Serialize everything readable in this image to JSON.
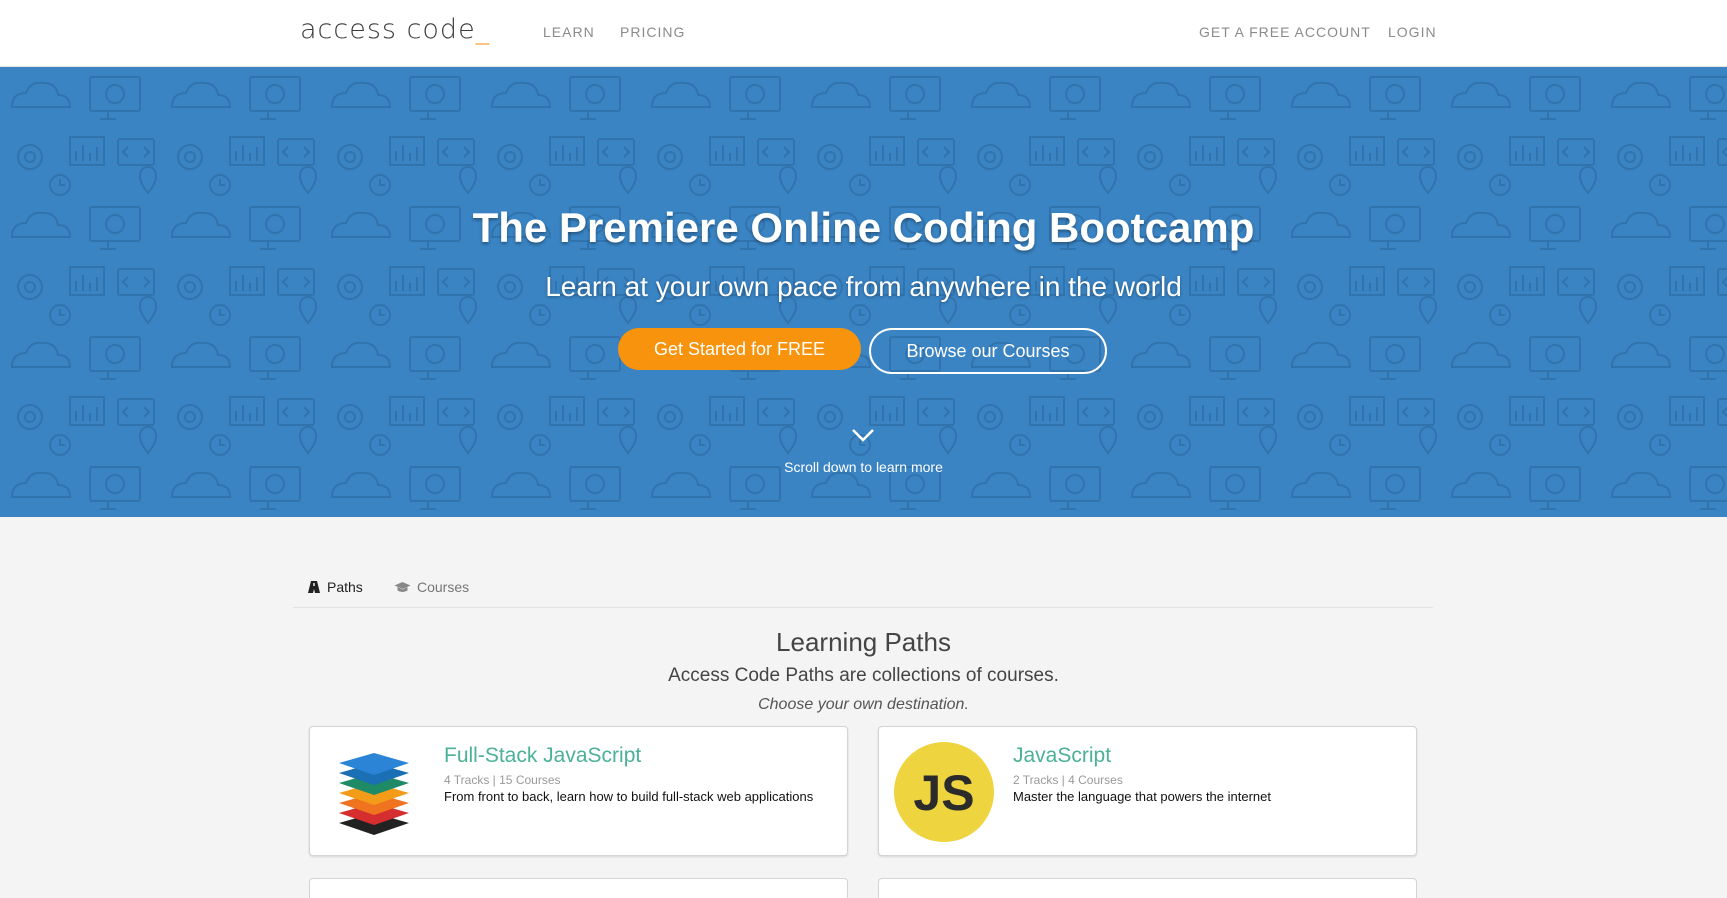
{
  "nav": {
    "logo_text": "access code",
    "logo_cursor": "_",
    "links": {
      "learn": "LEARN",
      "pricing": "PRICING",
      "free_account": "GET A FREE ACCOUNT",
      "login": "LOGIN"
    }
  },
  "hero": {
    "title": "The Premiere Online Coding Bootcamp",
    "subtitle": "Learn at your own pace from anywhere in the world",
    "primary_button": "Get Started for FREE",
    "secondary_button": "Browse our Courses",
    "scroll_hint": "Scroll down to learn more",
    "background_color": "#3a84c4",
    "primary_color": "#f7930d"
  },
  "tabs": {
    "paths": "Paths",
    "courses": "Courses"
  },
  "section": {
    "title": "Learning Paths",
    "subtitle": "Access Code Paths are collections of courses.",
    "note": "Choose your own destination."
  },
  "paths": [
    {
      "title": "Full-Stack JavaScript",
      "meta": "4 Tracks | 15 Courses",
      "description": "From front to back, learn how to build full-stack web applications",
      "icon": "layers-stack-icon"
    },
    {
      "title": "JavaScript",
      "meta": "2 Tracks | 4 Courses",
      "description": "Master the language that powers the internet",
      "icon": "js-logo-icon",
      "icon_text": "JS"
    }
  ],
  "accent_color": "#4bb197"
}
